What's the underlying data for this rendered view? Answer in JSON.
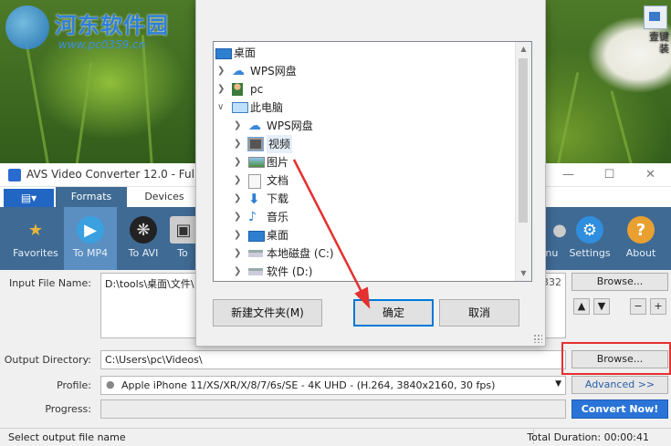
{
  "desktop": {
    "watermark_title": "河东软件园",
    "watermark_url": "www.pc0359.cn",
    "icon_label": "壹键装"
  },
  "avs": {
    "title": "AVS Video Converter 12.0 - Full",
    "tabs": [
      {
        "label": "Formats"
      },
      {
        "label": "Devices"
      }
    ],
    "toolbar": [
      {
        "label": "Favorites",
        "icon": "star-icon"
      },
      {
        "label": "To MP4",
        "icon": "play-disc-icon"
      },
      {
        "label": "To AVI",
        "icon": "film-reel-icon"
      },
      {
        "label": "To",
        "icon": "dvd-icon"
      },
      {
        "label": "enu",
        "icon": "menu-icon"
      },
      {
        "label": "Settings",
        "icon": "gear-icon"
      },
      {
        "label": "About",
        "icon": "question-icon"
      }
    ],
    "input_label": "Input File Name:",
    "input_value": "D:\\tools\\桌面\\文件\\",
    "input_duration": "4.332",
    "browse_label": "Browse...",
    "output_label": "Output Directory:",
    "output_value": "C:\\Users\\pc\\Videos\\",
    "profile_label": "Profile:",
    "profile_value": "Apple iPhone 11/XS/XR/X/8/7/6s/SE - 4K UHD - (H.264, 3840x2160, 30 fps)",
    "advanced_label": "Advanced >>",
    "progress_label": "Progress:",
    "convert_label": "Convert Now!",
    "status_left": "Select output file name",
    "status_right": "Total Duration: 00:00:41"
  },
  "dialog": {
    "tree": [
      {
        "label": "桌面",
        "level": 0,
        "expand": "",
        "icon": "desktop-icon"
      },
      {
        "label": "WPS网盘",
        "level": 1,
        "expand": ">",
        "icon": "cloud-icon"
      },
      {
        "label": "pc",
        "level": 1,
        "expand": ">",
        "icon": "user-icon"
      },
      {
        "label": "此电脑",
        "level": 1,
        "expand": "v",
        "icon": "computer-icon"
      },
      {
        "label": "WPS网盘",
        "level": 2,
        "expand": ">",
        "icon": "cloud-icon"
      },
      {
        "label": "视频",
        "level": 2,
        "expand": ">",
        "icon": "video-folder-icon",
        "selected": true
      },
      {
        "label": "图片",
        "level": 2,
        "expand": ">",
        "icon": "pictures-folder-icon"
      },
      {
        "label": "文档",
        "level": 2,
        "expand": ">",
        "icon": "documents-folder-icon"
      },
      {
        "label": "下载",
        "level": 2,
        "expand": ">",
        "icon": "download-icon"
      },
      {
        "label": "音乐",
        "level": 2,
        "expand": ">",
        "icon": "music-icon"
      },
      {
        "label": "桌面",
        "level": 2,
        "expand": ">",
        "icon": "desktop-icon"
      },
      {
        "label": "本地磁盘 (C:)",
        "level": 2,
        "expand": ">",
        "icon": "drive-icon"
      },
      {
        "label": "软件 (D:)",
        "level": 2,
        "expand": ">",
        "icon": "drive-icon"
      }
    ],
    "new_folder_label": "新建文件夹(M)",
    "ok_label": "确定",
    "cancel_label": "取消"
  },
  "colors": {
    "accent": "#2a74d8",
    "toolbar": "#3f6a94",
    "highlight": "#e53030"
  }
}
